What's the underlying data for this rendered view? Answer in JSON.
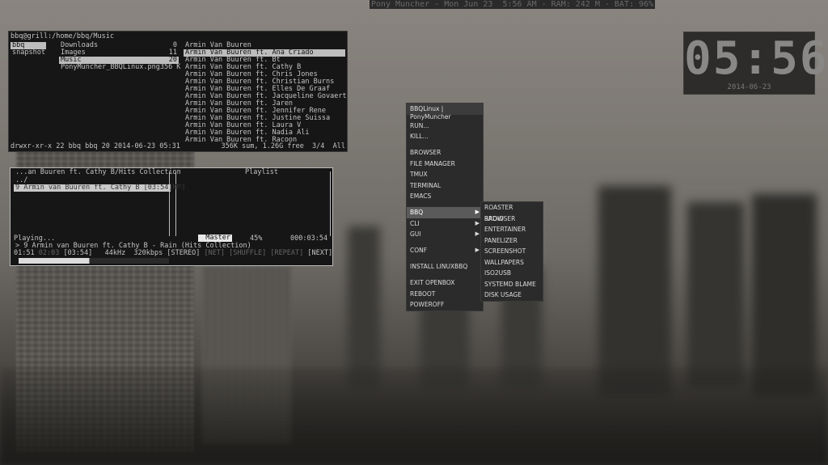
{
  "topbar": {
    "text": "Pony Muncher - Mon Jun 23  5:56 AM - RAM: 242 M - BAT: 96%"
  },
  "ranger": {
    "path": "bbq@grill:/home/bbq/Music",
    "col1": [
      {
        "name": "bbq",
        "selected": true
      },
      {
        "name": "snapshot",
        "selected": false
      }
    ],
    "col2": [
      {
        "name": "Downloads",
        "size": "0",
        "selected": false
      },
      {
        "name": "Images",
        "size": "11",
        "selected": false
      },
      {
        "name": "Music",
        "size": "20",
        "selected": true
      },
      {
        "name": "PonyMuncher_BBQLinux.png",
        "size": "356 K",
        "selected": false
      }
    ],
    "col3": [
      {
        "name": "Armin Van Buuren",
        "selected": false
      },
      {
        "name": "Armin Van Buuren ft. Ana Criado",
        "selected": true
      },
      {
        "name": "Armin Van Buuren ft. Bt",
        "selected": false
      },
      {
        "name": "Armin Van Buuren ft. Cathy B",
        "selected": false
      },
      {
        "name": "Armin Van Buuren ft. Chris Jones",
        "selected": false
      },
      {
        "name": "Armin Van Buuren ft. Christian Burns",
        "selected": false
      },
      {
        "name": "Armin Van Buuren ft. Elles De Graaf",
        "selected": false
      },
      {
        "name": "Armin Van Buuren ft. Jacqueline Govaert",
        "selected": false
      },
      {
        "name": "Armin Van Buuren ft. Jaren",
        "selected": false
      },
      {
        "name": "Armin Van Buuren ft. Jennifer Rene",
        "selected": false
      },
      {
        "name": "Armin Van Buuren ft. Justine Suissa",
        "selected": false
      },
      {
        "name": "Armin Van Buuren ft. Laura V",
        "selected": false
      },
      {
        "name": "Armin Van Buuren ft. Nadia Ali",
        "selected": false
      },
      {
        "name": "Armin Van Buuren ft. Racoon",
        "selected": false
      }
    ],
    "status_left": "drwxr-xr-x 22 bbq bbq 20 2014-06-23 05:31",
    "status_right": "356K sum, 1.26G free  3/4  All"
  },
  "cmus": {
    "left_title": "...an Buuren ft. Cathy B/Hits Collection",
    "right_title": "Playlist",
    "updir": "../",
    "track": "9 Armin van Buuren ft. Cathy B [03:54]MP3",
    "playing": "Playing...",
    "volume_label": "Master",
    "volume_pct": "45%",
    "volume_level": 0.45,
    "time": "000:03:54",
    "now_playing": "> 9 Armin van Buuren ft. Cathy B - Rain (Hits Collection)",
    "info_pos": "01:51",
    "info_dim1": "02:03",
    "info_main": "[03:54]   44kHz  320kbps [STEREO]",
    "info_dim2": "[NET] [SHUFFLE] [REPEAT]",
    "info_next": "[NEXT]",
    "progress": 0.47
  },
  "clock": {
    "time": "05:56",
    "date": "2014-06-23"
  },
  "menu": {
    "title": "BBQLinux | PonyMuncher",
    "groups": [
      [
        {
          "label": "RUN..."
        },
        {
          "label": "KILL..."
        }
      ],
      [
        {
          "label": "BROWSER"
        },
        {
          "label": "FILE MANAGER"
        },
        {
          "label": "TMUX"
        },
        {
          "label": "TERMINAL"
        },
        {
          "label": "EMACS"
        }
      ],
      [
        {
          "label": "BBQ",
          "submenu": true,
          "selected": true
        },
        {
          "label": "CLI",
          "submenu": true
        },
        {
          "label": "GUI",
          "submenu": true
        }
      ],
      [
        {
          "label": "CONF",
          "submenu": true
        }
      ],
      [
        {
          "label": "INSTALL LINUXBBQ"
        }
      ],
      [
        {
          "label": "EXIT OPENBOX"
        },
        {
          "label": "REBOOT"
        },
        {
          "label": "POWEROFF"
        }
      ]
    ],
    "arrow": "▶",
    "submenu_items": [
      "ROASTER BROWSER",
      "RADIO",
      "ENTERTAINER",
      "PANELIZER",
      "SCREENSHOT",
      "WALLPAPERS",
      "ISO2USB",
      "SYSTEMD BLAME",
      "DISK USAGE"
    ]
  }
}
